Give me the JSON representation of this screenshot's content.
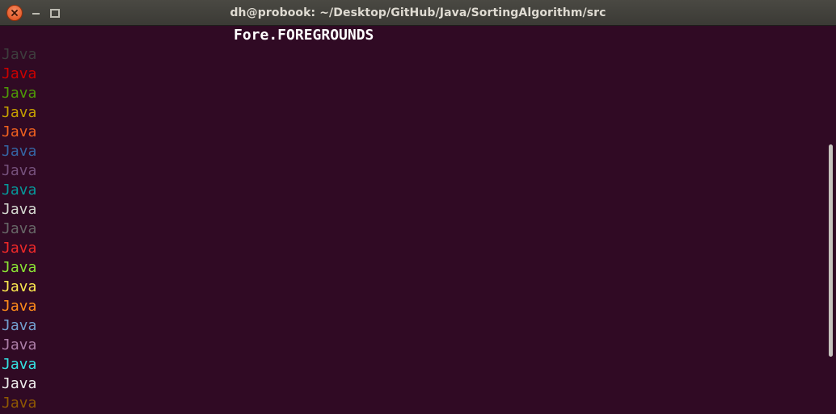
{
  "window": {
    "title": "dh@probook: ~/Desktop/GitHub/Java/SortingAlgorithm/src"
  },
  "controls": {
    "close_icon": "close-icon",
    "minimize_icon": "minimize-icon",
    "maximize_icon": "maximize-icon"
  },
  "terminal": {
    "background": "#300a24",
    "heading": "Fore.FOREGROUNDS",
    "lines": [
      {
        "text": "Java",
        "color": "#3d3d3d"
      },
      {
        "text": "Java",
        "color": "#cc0000"
      },
      {
        "text": "Java",
        "color": "#4e9a06"
      },
      {
        "text": "Java",
        "color": "#c4a000"
      },
      {
        "text": "Java",
        "color": "#f0611f"
      },
      {
        "text": "Java",
        "color": "#3465a4"
      },
      {
        "text": "Java",
        "color": "#75507b"
      },
      {
        "text": "Java",
        "color": "#06989a"
      },
      {
        "text": "Java",
        "color": "#d3d7cf"
      },
      {
        "text": "Java",
        "color": "#666666"
      },
      {
        "text": "Java",
        "color": "#ef2929"
      },
      {
        "text": "Java",
        "color": "#8ae234"
      },
      {
        "text": "Java",
        "color": "#fce94f"
      },
      {
        "text": "Java",
        "color": "#ff8c1a"
      },
      {
        "text": "Java",
        "color": "#729fcf"
      },
      {
        "text": "Java",
        "color": "#ad7fa8"
      },
      {
        "text": "Java",
        "color": "#34e2e2"
      },
      {
        "text": "Java",
        "color": "#eeeeec"
      },
      {
        "text": "Java",
        "color": "#8f5902"
      }
    ]
  }
}
